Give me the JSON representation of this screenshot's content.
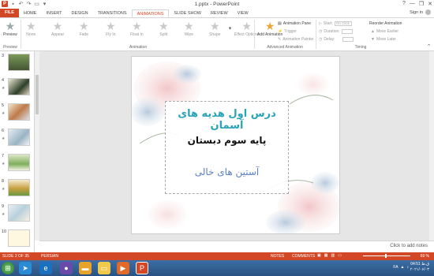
{
  "window": {
    "title": "1.pptx - PowerPoint",
    "controls": [
      "?",
      "—",
      "❐",
      "✕"
    ]
  },
  "tabs": [
    "FILE",
    "HOME",
    "INSERT",
    "DESIGN",
    "TRANSITIONS",
    "ANIMATIONS",
    "SLIDE SHOW",
    "REVIEW",
    "VIEW"
  ],
  "active_tab": "ANIMATIONS",
  "signin": "Sign in",
  "ribbon": {
    "preview": {
      "label": "Preview",
      "group": "Preview"
    },
    "animations": [
      "None",
      "Appear",
      "Fade",
      "Fly In",
      "Float In",
      "Split",
      "Wipe",
      "Shape"
    ],
    "animation_group": "Animation",
    "effect_options": "Effect Options",
    "add_animation": "Add Animation",
    "animation_pane": "Animation Pane",
    "trigger": "Trigger",
    "animation_painter": "Animation Painter",
    "advanced_group": "Advanced Animation",
    "start": "Start:",
    "start_value": "On Click",
    "duration": "Duration:",
    "delay": "Delay:",
    "timing_group": "Timing",
    "reorder": "Reorder Animation",
    "move_earlier": "Move Earlier",
    "move_later": "Move Later"
  },
  "thumbnails": [
    {
      "num": "3",
      "star": ""
    },
    {
      "num": "4",
      "star": "★"
    },
    {
      "num": "5",
      "star": "★"
    },
    {
      "num": "6",
      "star": "★"
    },
    {
      "num": "7",
      "star": "★"
    },
    {
      "num": "8",
      "star": "★"
    },
    {
      "num": "9",
      "star": "★"
    },
    {
      "num": "10",
      "star": ""
    }
  ],
  "slide": {
    "line1": "درس اول هدیه های آسمان",
    "line2": "پایه سوم دبستان",
    "line3": "آستین های خالی"
  },
  "notes_placeholder": "Click to add notes",
  "status": {
    "slide_of": "SLIDE 2 OF 35",
    "language": "PERSIAN",
    "notes": "NOTES",
    "comments": "COMMENTS",
    "zoom": "69 %"
  },
  "taskbar": {
    "clock_time": "04:51 ق.ظ",
    "clock_date": "۲۰۲۱/۰۶/۰۳",
    "lang": "FA"
  }
}
